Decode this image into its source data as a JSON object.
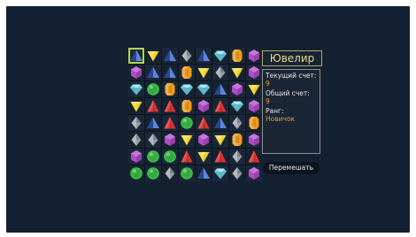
{
  "game": {
    "title": "Ювелир",
    "score_label": "Текущий счет:",
    "score_value": "9",
    "total_label": "Общий счет:",
    "total_value": "9",
    "rank_label": "Ранг:",
    "rank_value": "Новичок",
    "shuffle_label": "Перемешать",
    "selected_cell": [
      0,
      0
    ]
  },
  "gem_colors": {
    "blue": "#3e6fd8",
    "yellow": "#f1d21e",
    "silver": "#9aa0a8",
    "cyan": "#74d8ee",
    "orange": "#f29b1a",
    "purple": "#b04cc9",
    "green": "#3fbf4a",
    "red": "#e2332f"
  },
  "board": [
    [
      "blue",
      "yellow",
      "blue",
      "silver",
      "blue",
      "cyan",
      "orange",
      "purple"
    ],
    [
      "purple",
      "blue",
      "blue",
      "orange",
      "yellow",
      "silver",
      "yellow",
      "purple"
    ],
    [
      "cyan",
      "green",
      "orange",
      "cyan",
      "cyan",
      "blue",
      "purple",
      "yellow"
    ],
    [
      "yellow",
      "red",
      "red",
      "orange",
      "purple",
      "red",
      "cyan",
      "purple"
    ],
    [
      "silver",
      "blue",
      "red",
      "green",
      "red",
      "blue",
      "silver",
      "orange"
    ],
    [
      "silver",
      "silver",
      "purple",
      "yellow",
      "purple",
      "yellow",
      "orange",
      "purple"
    ],
    [
      "purple",
      "green",
      "green",
      "red",
      "yellow",
      "red",
      "silver",
      "red"
    ],
    [
      "green",
      "green",
      "silver",
      "green",
      "blue",
      "cyan",
      "silver",
      "purple"
    ]
  ]
}
